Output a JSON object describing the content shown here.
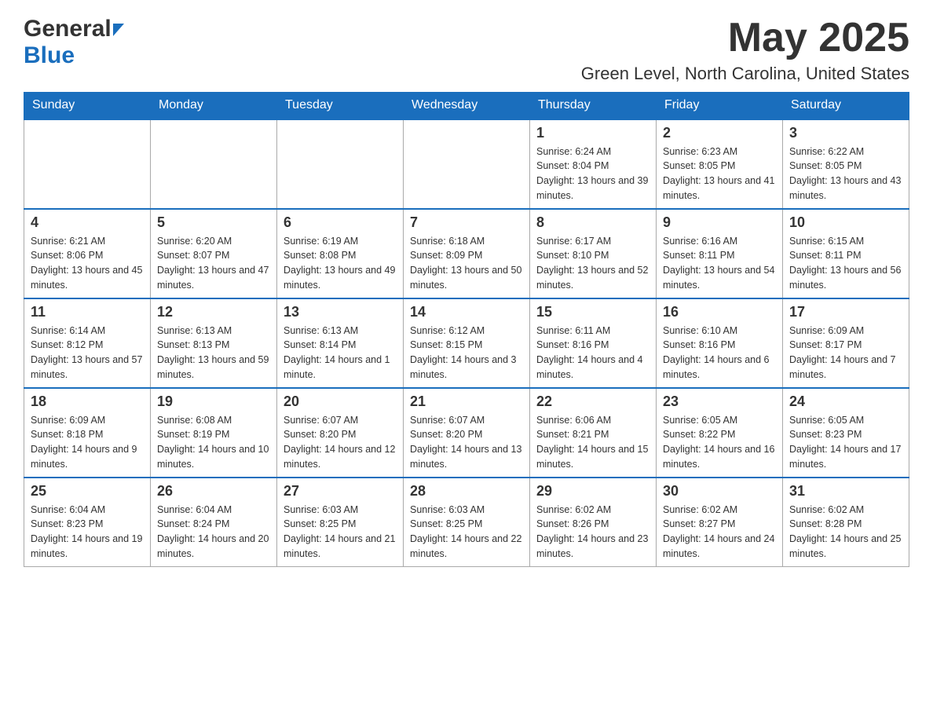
{
  "header": {
    "logo_general": "General",
    "logo_blue": "Blue",
    "month_title": "May 2025",
    "location": "Green Level, North Carolina, United States"
  },
  "days_of_week": [
    "Sunday",
    "Monday",
    "Tuesday",
    "Wednesday",
    "Thursday",
    "Friday",
    "Saturday"
  ],
  "weeks": [
    [
      {
        "day": "",
        "info": ""
      },
      {
        "day": "",
        "info": ""
      },
      {
        "day": "",
        "info": ""
      },
      {
        "day": "",
        "info": ""
      },
      {
        "day": "1",
        "info": "Sunrise: 6:24 AM\nSunset: 8:04 PM\nDaylight: 13 hours and 39 minutes."
      },
      {
        "day": "2",
        "info": "Sunrise: 6:23 AM\nSunset: 8:05 PM\nDaylight: 13 hours and 41 minutes."
      },
      {
        "day": "3",
        "info": "Sunrise: 6:22 AM\nSunset: 8:05 PM\nDaylight: 13 hours and 43 minutes."
      }
    ],
    [
      {
        "day": "4",
        "info": "Sunrise: 6:21 AM\nSunset: 8:06 PM\nDaylight: 13 hours and 45 minutes."
      },
      {
        "day": "5",
        "info": "Sunrise: 6:20 AM\nSunset: 8:07 PM\nDaylight: 13 hours and 47 minutes."
      },
      {
        "day": "6",
        "info": "Sunrise: 6:19 AM\nSunset: 8:08 PM\nDaylight: 13 hours and 49 minutes."
      },
      {
        "day": "7",
        "info": "Sunrise: 6:18 AM\nSunset: 8:09 PM\nDaylight: 13 hours and 50 minutes."
      },
      {
        "day": "8",
        "info": "Sunrise: 6:17 AM\nSunset: 8:10 PM\nDaylight: 13 hours and 52 minutes."
      },
      {
        "day": "9",
        "info": "Sunrise: 6:16 AM\nSunset: 8:11 PM\nDaylight: 13 hours and 54 minutes."
      },
      {
        "day": "10",
        "info": "Sunrise: 6:15 AM\nSunset: 8:11 PM\nDaylight: 13 hours and 56 minutes."
      }
    ],
    [
      {
        "day": "11",
        "info": "Sunrise: 6:14 AM\nSunset: 8:12 PM\nDaylight: 13 hours and 57 minutes."
      },
      {
        "day": "12",
        "info": "Sunrise: 6:13 AM\nSunset: 8:13 PM\nDaylight: 13 hours and 59 minutes."
      },
      {
        "day": "13",
        "info": "Sunrise: 6:13 AM\nSunset: 8:14 PM\nDaylight: 14 hours and 1 minute."
      },
      {
        "day": "14",
        "info": "Sunrise: 6:12 AM\nSunset: 8:15 PM\nDaylight: 14 hours and 3 minutes."
      },
      {
        "day": "15",
        "info": "Sunrise: 6:11 AM\nSunset: 8:16 PM\nDaylight: 14 hours and 4 minutes."
      },
      {
        "day": "16",
        "info": "Sunrise: 6:10 AM\nSunset: 8:16 PM\nDaylight: 14 hours and 6 minutes."
      },
      {
        "day": "17",
        "info": "Sunrise: 6:09 AM\nSunset: 8:17 PM\nDaylight: 14 hours and 7 minutes."
      }
    ],
    [
      {
        "day": "18",
        "info": "Sunrise: 6:09 AM\nSunset: 8:18 PM\nDaylight: 14 hours and 9 minutes."
      },
      {
        "day": "19",
        "info": "Sunrise: 6:08 AM\nSunset: 8:19 PM\nDaylight: 14 hours and 10 minutes."
      },
      {
        "day": "20",
        "info": "Sunrise: 6:07 AM\nSunset: 8:20 PM\nDaylight: 14 hours and 12 minutes."
      },
      {
        "day": "21",
        "info": "Sunrise: 6:07 AM\nSunset: 8:20 PM\nDaylight: 14 hours and 13 minutes."
      },
      {
        "day": "22",
        "info": "Sunrise: 6:06 AM\nSunset: 8:21 PM\nDaylight: 14 hours and 15 minutes."
      },
      {
        "day": "23",
        "info": "Sunrise: 6:05 AM\nSunset: 8:22 PM\nDaylight: 14 hours and 16 minutes."
      },
      {
        "day": "24",
        "info": "Sunrise: 6:05 AM\nSunset: 8:23 PM\nDaylight: 14 hours and 17 minutes."
      }
    ],
    [
      {
        "day": "25",
        "info": "Sunrise: 6:04 AM\nSunset: 8:23 PM\nDaylight: 14 hours and 19 minutes."
      },
      {
        "day": "26",
        "info": "Sunrise: 6:04 AM\nSunset: 8:24 PM\nDaylight: 14 hours and 20 minutes."
      },
      {
        "day": "27",
        "info": "Sunrise: 6:03 AM\nSunset: 8:25 PM\nDaylight: 14 hours and 21 minutes."
      },
      {
        "day": "28",
        "info": "Sunrise: 6:03 AM\nSunset: 8:25 PM\nDaylight: 14 hours and 22 minutes."
      },
      {
        "day": "29",
        "info": "Sunrise: 6:02 AM\nSunset: 8:26 PM\nDaylight: 14 hours and 23 minutes."
      },
      {
        "day": "30",
        "info": "Sunrise: 6:02 AM\nSunset: 8:27 PM\nDaylight: 14 hours and 24 minutes."
      },
      {
        "day": "31",
        "info": "Sunrise: 6:02 AM\nSunset: 8:28 PM\nDaylight: 14 hours and 25 minutes."
      }
    ]
  ]
}
